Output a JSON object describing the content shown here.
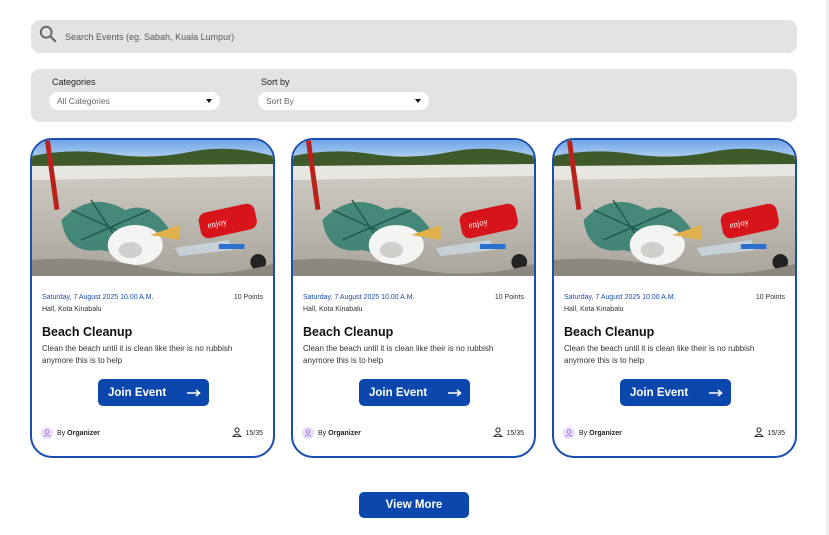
{
  "search": {
    "placeholder": "Search Events (eg. Sabah, Kuala Lumpur)",
    "icon": "search-icon"
  },
  "filters": {
    "categories": {
      "label": "Categories",
      "selected": "All Categories"
    },
    "sort_by": {
      "label": "Sort by",
      "selected": "Sort By"
    }
  },
  "events": [
    {
      "date": "Saturday, 7 August 2025 10.00 A.M.",
      "points": "10 Points",
      "location": "Hall, Kota Kinabalu",
      "title": "Beach Cleanup",
      "description": "Clean the beach until it is clean like their is no rubbish anymore this is to help",
      "join_label": "Join Event",
      "organizer_prefix": "By",
      "organizer": "Organizer",
      "capacity": "15/35"
    },
    {
      "date": "Saturday, 7 August 2025 10.00 A.M.",
      "points": "10 Points",
      "location": "Hall, Kota Kinabalu",
      "title": "Beach Cleanup",
      "description": "Clean the beach until it is clean like their is no rubbish anymore this is to help",
      "join_label": "Join Event",
      "organizer_prefix": "By",
      "organizer": "Organizer",
      "capacity": "15/35"
    },
    {
      "date": "Saturday, 7 August 2025 10.00 A.M.",
      "points": "10 Points",
      "location": "Hall, Kota Kinabalu",
      "title": "Beach Cleanup",
      "description": "Clean the beach until it is clean like their is no rubbish anymore this is to help",
      "join_label": "Join Event",
      "organizer_prefix": "By",
      "organizer": "Organizer",
      "capacity": "15/35"
    }
  ],
  "view_more_label": "View More",
  "colors": {
    "accent": "#0b47ad",
    "card_border": "#1a4db0",
    "panel_bg": "#e3e3e3"
  }
}
